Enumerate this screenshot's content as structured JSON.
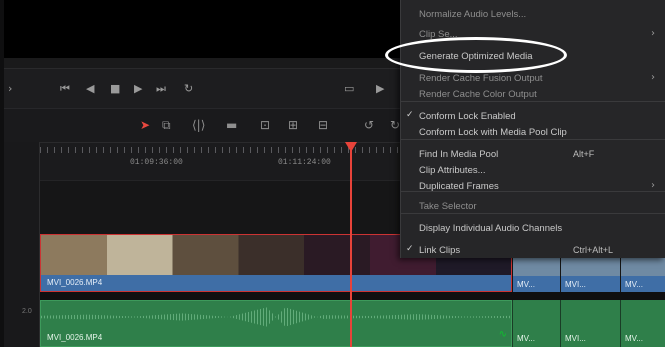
{
  "transport": {
    "icons": [
      "first-frame-icon",
      "prev-frame-icon",
      "stop-icon",
      "play-icon",
      "last-frame-icon",
      "loop-icon",
      "fullscreen-icon",
      "next-icon"
    ]
  },
  "timeline": {
    "timecodes": [
      "01:09:36:00",
      "01:11:24:00"
    ],
    "video_clip_name": "MVI_0026.MP4",
    "audio_clip_name": "MVI_0026.MP4",
    "right_clip_labels": [
      "MV...",
      "MVI...",
      "MV..."
    ],
    "audio_track_number": "2.0"
  },
  "menu": {
    "items": [
      {
        "label": "Normalize Audio Levels...",
        "shortcut": "",
        "submenu": false,
        "checked": false,
        "dim": true
      },
      {
        "label": "Clip Se...",
        "shortcut": "",
        "submenu": true,
        "checked": false,
        "dim": true
      },
      {
        "label": "Generate Optimized Media",
        "shortcut": "",
        "submenu": false,
        "checked": false,
        "dim": false
      },
      {
        "label": "Render Cache Fusion Output",
        "shortcut": "",
        "submenu": true,
        "checked": false,
        "dim": true
      },
      {
        "label": "Render Cache Color Output",
        "shortcut": "",
        "submenu": false,
        "checked": false,
        "dim": true
      },
      {
        "label": "Conform Lock Enabled",
        "shortcut": "",
        "submenu": false,
        "checked": true,
        "dim": false
      },
      {
        "label": "Conform Lock with Media Pool Clip",
        "shortcut": "",
        "submenu": false,
        "checked": false,
        "dim": false
      },
      {
        "label": "Find In Media Pool",
        "shortcut": "Alt+F",
        "submenu": false,
        "checked": false,
        "dim": false
      },
      {
        "label": "Clip Attributes...",
        "shortcut": "",
        "submenu": false,
        "checked": false,
        "dim": false
      },
      {
        "label": "Duplicated Frames",
        "shortcut": "",
        "submenu": true,
        "checked": false,
        "dim": false
      },
      {
        "label": "Take Selector",
        "shortcut": "",
        "submenu": false,
        "checked": false,
        "dim": true
      },
      {
        "label": "Display Individual Audio Channels",
        "shortcut": "",
        "submenu": false,
        "checked": false,
        "dim": false
      },
      {
        "label": "Link Clips",
        "shortcut": "Ctrl+Alt+L",
        "submenu": false,
        "checked": true,
        "dim": false
      }
    ]
  },
  "colors": {
    "playhead": "#e8433a",
    "video_clip": "#3f6ea6",
    "audio_clip": "#2f7f4a",
    "menu_bg": "#262628"
  }
}
